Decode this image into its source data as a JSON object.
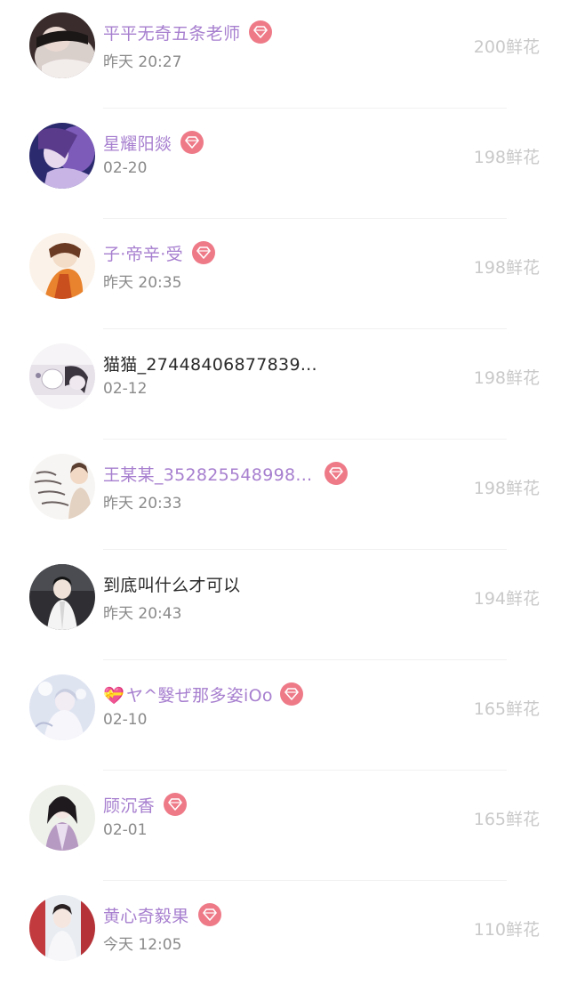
{
  "list_items": [
    {
      "name": "平平无奇五条老师",
      "time": "昨天 20:27",
      "flowers": "200鲜花",
      "vip": true
    },
    {
      "name": "星耀阳燚",
      "time": "02-20",
      "flowers": "198鲜花",
      "vip": true
    },
    {
      "name": "子·帝辛·受",
      "time": "昨天 20:35",
      "flowers": "198鲜花",
      "vip": true
    },
    {
      "name": "猫猫_27448406877839...",
      "time": "02-12",
      "flowers": "198鲜花",
      "vip": false
    },
    {
      "name": "王某某_352825548998...",
      "time": "昨天 20:33",
      "flowers": "198鲜花",
      "vip": true
    },
    {
      "name": "到底叫什么才可以",
      "time": "昨天 20:43",
      "flowers": "194鲜花",
      "vip": false
    },
    {
      "name_prefix_emoji": "💝",
      "name": "ヤ^嫛ぜ那多姿iOo",
      "time": "02-10",
      "flowers": "165鲜花",
      "vip": true
    },
    {
      "name": "顾沉香",
      "time": "02-01",
      "flowers": "165鲜花",
      "vip": true
    },
    {
      "name": "黄心奇毅果",
      "time": "今天 12:05",
      "flowers": "110鲜花",
      "vip": true
    }
  ],
  "colors": {
    "vip_name": "#a77fcf",
    "plain_name": "#2a2a2a",
    "time": "#8a8a8a",
    "flowers": "#c9c9c9",
    "vip_badge": "#ee7a88",
    "divider": "#f1f1f1"
  }
}
